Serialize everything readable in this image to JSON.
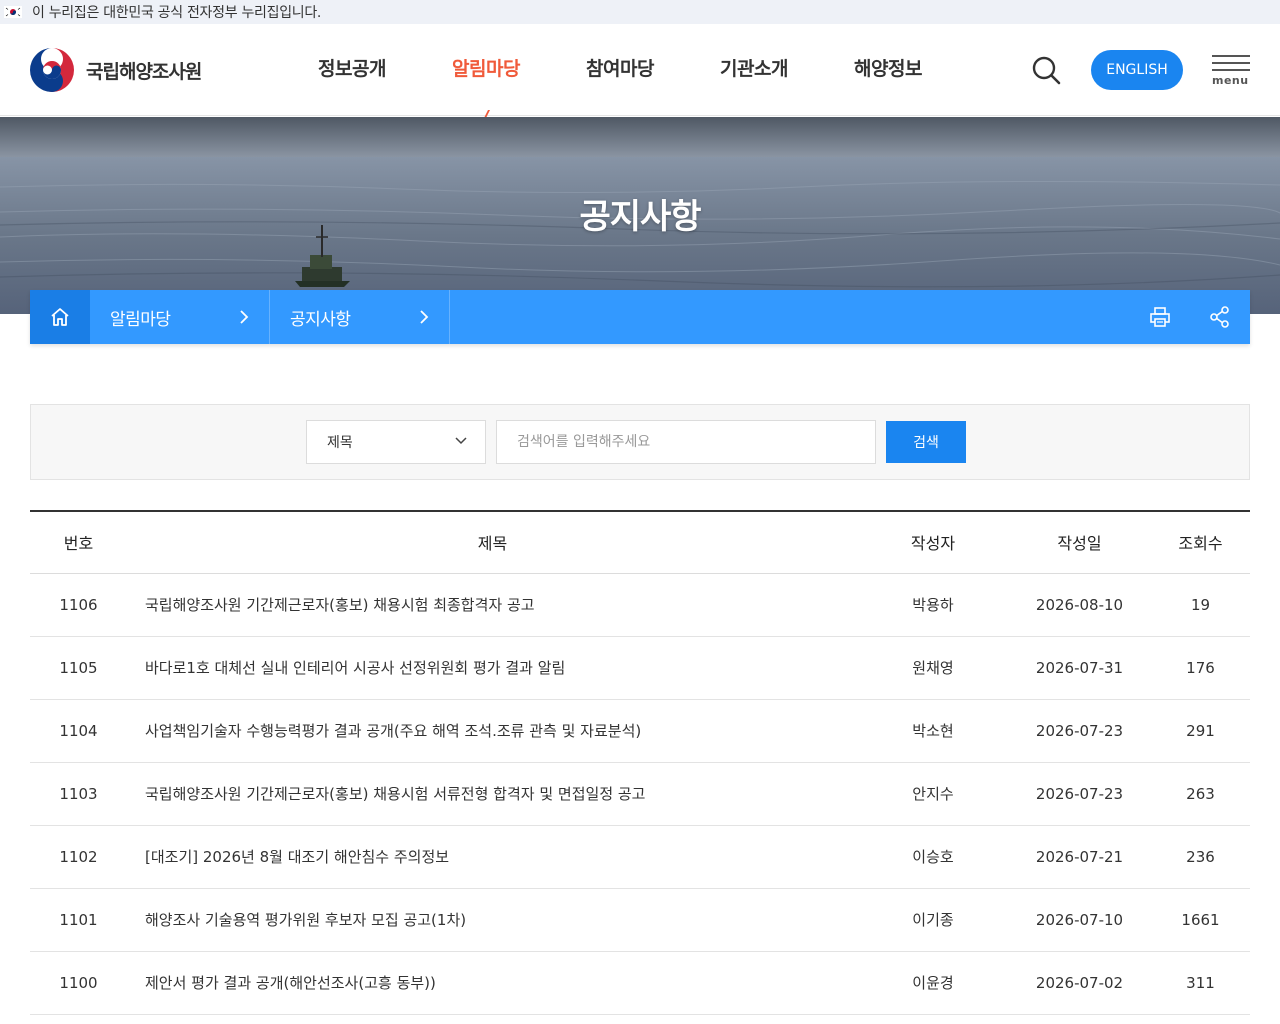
{
  "gov_banner": {
    "text": "이 누리집은 대한민국 공식 전자정부 누리집입니다."
  },
  "header": {
    "logo_text": "국립해양조사원",
    "nav": [
      {
        "label": "정보공개",
        "active": false
      },
      {
        "label": "알림마당",
        "active": true
      },
      {
        "label": "참여마당",
        "active": false
      },
      {
        "label": "기관소개",
        "active": false
      },
      {
        "label": "해양정보",
        "active": false
      }
    ],
    "search_icon": "search-icon",
    "english_label": "ENGLISH",
    "menu_label": "menu",
    "active_color": "#f05a3a"
  },
  "hero": {
    "title": "공지사항"
  },
  "breadcrumb": {
    "home_icon": "home-icon",
    "items": [
      "알림마당",
      "공지사항"
    ],
    "print_icon": "print-icon",
    "share_icon": "share-icon"
  },
  "search": {
    "select_value": "제목",
    "placeholder": "검색어를 입력해주세요",
    "submit_label": "검색",
    "button_color": "#1a85f0"
  },
  "table": {
    "headers": [
      "번호",
      "제목",
      "작성자",
      "작성일",
      "조회수"
    ],
    "rows": [
      {
        "num": "1106",
        "title": "국립해양조사원 기간제근로자(홍보) 채용시험 최종합격자 공고",
        "writer": "박용하",
        "date": "2026-08-10",
        "views": "19"
      },
      {
        "num": "1105",
        "title": "바다로1호 대체선 실내 인테리어 시공사 선정위원회 평가 결과 알림",
        "writer": "원채영",
        "date": "2026-07-31",
        "views": "176"
      },
      {
        "num": "1104",
        "title": "사업책임기술자 수행능력평가 결과 공개(주요 해역 조석.조류 관측 및 자료분석)",
        "writer": "박소현",
        "date": "2026-07-23",
        "views": "291"
      },
      {
        "num": "1103",
        "title": "국립해양조사원 기간제근로자(홍보) 채용시험 서류전형 합격자 및 면접일정 공고",
        "writer": "안지수",
        "date": "2026-07-23",
        "views": "263"
      },
      {
        "num": "1102",
        "title": "[대조기] 2026년 8월 대조기 해안침수 주의정보",
        "writer": "이승호",
        "date": "2026-07-21",
        "views": "236"
      },
      {
        "num": "1101",
        "title": "해양조사 기술용역 평가위원 후보자 모집 공고(1차)",
        "writer": "이기종",
        "date": "2026-07-10",
        "views": "1661"
      },
      {
        "num": "1100",
        "title": "제안서 평가 결과 공개(해안선조사(고흥 동부))",
        "writer": "이윤경",
        "date": "2026-07-02",
        "views": "311"
      }
    ]
  }
}
